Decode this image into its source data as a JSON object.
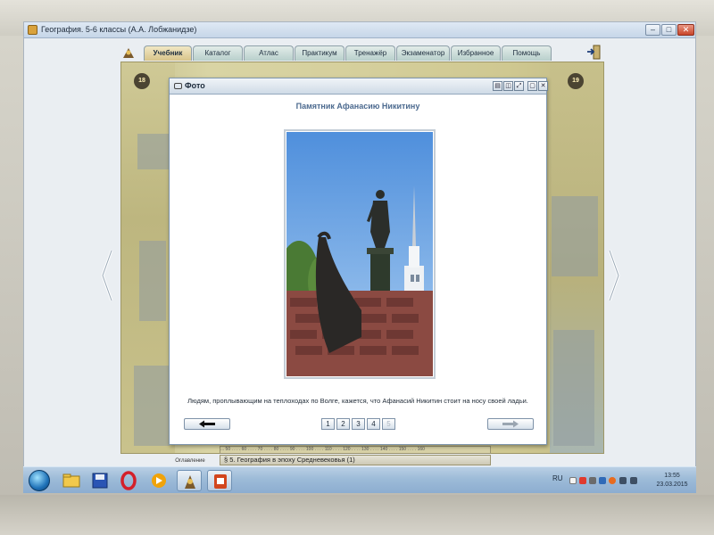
{
  "window": {
    "title": "География. 5-6 классы (А.А. Лобжанидзе)",
    "minimize": "–",
    "maximize": "□",
    "close": "✕"
  },
  "nav": {
    "tabs": [
      "Учебник",
      "Каталог",
      "Атлас",
      "Практикум",
      "Тренажёр",
      "Экзаменатор",
      "Избранное",
      "Помощь"
    ],
    "active_tab": "Учебник"
  },
  "book": {
    "page_left": "18",
    "page_right": "19",
    "contents_label": "Оглавление",
    "ruler_ticks": "... 50 . . . . 60 . . . . 70 . . . . 80 . . . . 90 . . . . 100 . . . . 110 . . . . 120 . . . . 130 . . . . 140 . . . . 150 . . . . 160",
    "section_title": "§ 5. География в эпоху Средневековья (1)"
  },
  "dialog": {
    "title": "Фото",
    "photo_title": "Памятник Афанасию Никитину",
    "caption": "Людям, проплывающим на теплоходах по Волге, кажется, что Афанасий Никитин стоит на носу своей ладьи.",
    "prev_icon": "arrow-left-icon",
    "next_icon": "arrow-right-icon",
    "pages": [
      "1",
      "2",
      "3",
      "4",
      "5"
    ],
    "disabled_page": "5"
  },
  "taskbar": {
    "language": "RU",
    "time": "13:55",
    "date": "23.03.2015",
    "items": [
      "start-orb",
      "folder-icon",
      "save-icon",
      "opera-icon",
      "media-player-icon",
      "textbook-app-icon",
      "powerpoint-icon"
    ]
  },
  "colors": {
    "accent": "#4c6a8f",
    "book_bg": "#d5cf9c",
    "taskbar": "#9dbbd8",
    "close_button": "#c9452a"
  }
}
